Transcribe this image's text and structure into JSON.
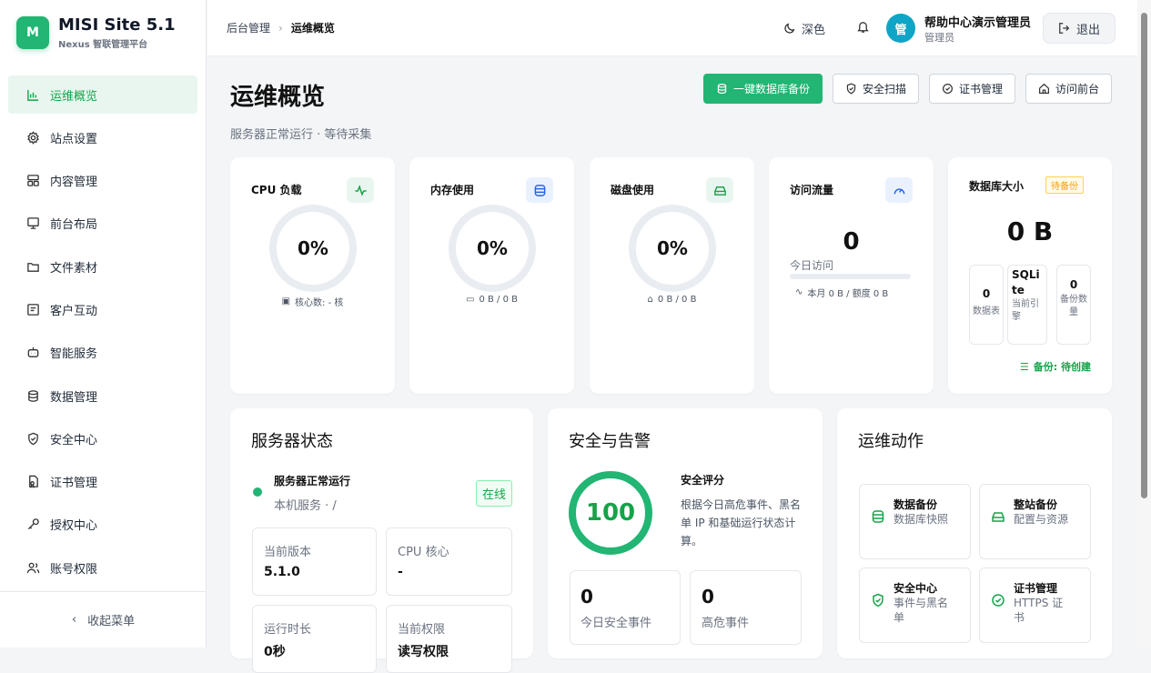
{
  "brand": {
    "logo_letter": "M",
    "name": "MISI Site 5.1",
    "subtitle": "Nexus 智联管理平台"
  },
  "sidebar": {
    "items": [
      {
        "label": "运维概览",
        "icon": "bar-chart-icon",
        "active": true
      },
      {
        "label": "站点设置",
        "icon": "gear-icon"
      },
      {
        "label": "内容管理",
        "icon": "layout-icon"
      },
      {
        "label": "前台布局",
        "icon": "monitor-icon"
      },
      {
        "label": "文件素材",
        "icon": "folder-icon"
      },
      {
        "label": "客户互动",
        "icon": "message-icon"
      },
      {
        "label": "智能服务",
        "icon": "robot-icon"
      },
      {
        "label": "数据管理",
        "icon": "database-icon"
      },
      {
        "label": "安全中心",
        "icon": "shield-icon"
      },
      {
        "label": "证书管理",
        "icon": "certificate-icon"
      },
      {
        "label": "授权中心",
        "icon": "key-icon"
      },
      {
        "label": "账号权限",
        "icon": "users-icon"
      }
    ],
    "collapse_label": "收起菜单"
  },
  "topbar": {
    "breadcrumb": [
      "后台管理",
      "运维概览"
    ],
    "theme_label": "深色",
    "avatar_text": "管",
    "user_name": "帮助中心演示管理员",
    "user_role": "管理员",
    "logout_label": "退出"
  },
  "page": {
    "title": "运维概览",
    "subtitle": "服务器正常运行 · 等待采集"
  },
  "actions": [
    "一键数据库备份",
    "安全扫描",
    "证书管理",
    "访问前台"
  ],
  "metrics": {
    "cpu": {
      "title": "CPU 负载",
      "value": "0%",
      "foot": "核心数: - 核"
    },
    "mem": {
      "title": "内存使用",
      "value": "0%",
      "foot": "0 B / 0 B"
    },
    "disk": {
      "title": "磁盘使用",
      "value": "0%",
      "foot": "0 B / 0 B"
    },
    "traffic": {
      "title": "访问流量",
      "value": "0",
      "label": "今日访问",
      "foot": "本月 0 B / 额度 0 B",
      "fill": 0
    },
    "db": {
      "title": "数据库大小",
      "badge": "待备份",
      "value": "0 B",
      "stats": [
        {
          "value": "0",
          "label": "数据表"
        },
        {
          "value": "SQLite",
          "label": "当前引擎"
        },
        {
          "value": "0",
          "label": "备份数量"
        }
      ],
      "backup": "备份: 待创建"
    }
  },
  "server": {
    "title": "服务器状态",
    "status_title": "服务器正常运行",
    "status_sub": "本机服务 · /",
    "badge": "在线",
    "fields": [
      {
        "label": "当前版本",
        "value": "5.1.0"
      },
      {
        "label": "CPU 核心",
        "value": "-"
      },
      {
        "label": "运行时长",
        "value": "0秒"
      },
      {
        "label": "当前权限",
        "value": "读写权限"
      }
    ]
  },
  "security": {
    "title": "安全与告警",
    "score": "100",
    "score_title": "安全评分",
    "score_desc": "根据今日高危事件、黑名单 IP 和基础运行状态计算。",
    "stats": [
      {
        "value": "0",
        "label": "今日安全事件"
      },
      {
        "value": "0",
        "label": "高危事件"
      }
    ]
  },
  "ops": {
    "title": "运维动作",
    "items": [
      {
        "title": "数据备份",
        "desc": "数据库快照",
        "icon": "database-icon"
      },
      {
        "title": "整站备份",
        "desc": "配置与资源",
        "icon": "drive-icon"
      },
      {
        "title": "安全中心",
        "desc": "事件与黑名单",
        "icon": "shield-icon"
      },
      {
        "title": "证书管理",
        "desc": "HTTPS 证书",
        "icon": "check-circle-icon"
      }
    ]
  },
  "colors": {
    "accent": "#22b573",
    "active_bg": "#e9f6ef",
    "badge_orange": "#f59e0b",
    "db_blue": "#2563eb"
  }
}
